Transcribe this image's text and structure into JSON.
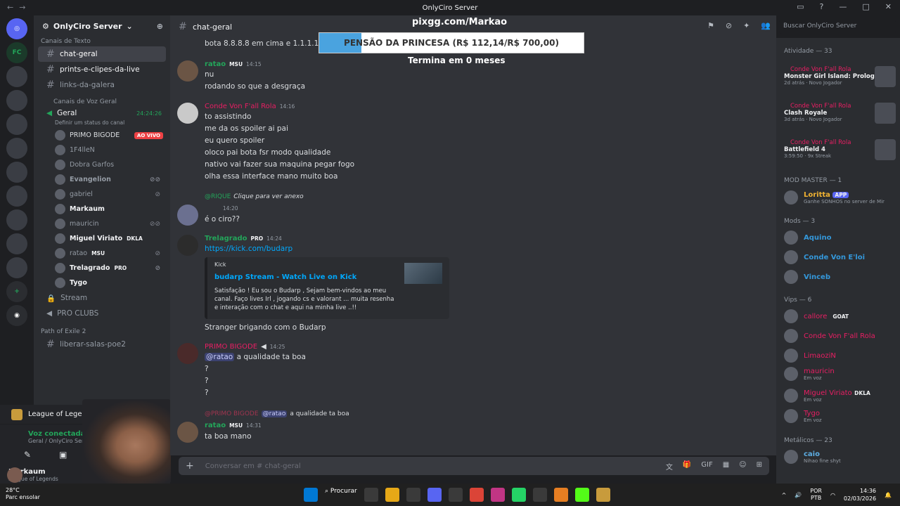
{
  "window": {
    "title": "OnlyCiro Server"
  },
  "server": {
    "name": "OnlyCiro Server",
    "search_placeholder": "Buscar OnlyCiro Server"
  },
  "overlay": {
    "url": "pixgg.com/Markao",
    "goal_label": "PENSÃO DA PRINCESA (R$ 112,14/R$ 700,00)",
    "goal_fraction": 0.16,
    "sub": "Termina em 0 meses"
  },
  "sidebar": {
    "cat_text": "Canais de Texto",
    "channels": [
      {
        "name": "chat-geral"
      },
      {
        "name": "prints-e-clipes-da-live"
      },
      {
        "name": "links-da-galera"
      }
    ],
    "cat_voice": "Canais de Voz Geral",
    "voice_channel": {
      "name": "Geral",
      "timer": "24:24:26",
      "status": "Definir um status do canal"
    },
    "voice_users": [
      {
        "name": "PRIMO BIGODE",
        "live": "AO VIVO"
      },
      {
        "name": "1F4lleN"
      },
      {
        "name": "Dobra Garfos"
      },
      {
        "name": "Evangelion"
      },
      {
        "name": "gabriel"
      },
      {
        "name": "Markaum"
      },
      {
        "name": "mauricin"
      },
      {
        "name": "Miguel Viriato",
        "tag": "DKLA"
      },
      {
        "name": "ratao",
        "tag": "MSU"
      },
      {
        "name": "Trelagrado",
        "tag": "PRO"
      },
      {
        "name": "Tygo"
      }
    ],
    "other": [
      {
        "name": "Stream"
      },
      {
        "name": "PRO CLUBS"
      }
    ],
    "cat_poe": "Path of Exile 2",
    "poe_channel": "liberar-salas-poe2"
  },
  "panel": {
    "game": "League of Legends",
    "voice": "Voz conectada",
    "voice_sub": "Geral / OnlyCiro Server",
    "user": "Markaum",
    "user_sub": "League of Legends"
  },
  "header": {
    "channel": "chat-geral"
  },
  "messages": [
    {
      "text": "bota 8.8.8.8 em cima e 1.1.1.1 em baix"
    },
    {
      "author": "ratao",
      "badge": "MSU",
      "time": "14:15",
      "lines": [
        "nu",
        "rodando so que a desgraça"
      ]
    },
    {
      "author": "Conde Von F'all  Rola",
      "time": "14:16",
      "lines": [
        "to assistindo",
        "me da os spoiler ai pai",
        "eu quero spoiler",
        "oloco pai bota fsr modo qualidade",
        "nativo vai fazer sua maquina pegar fogo",
        "olha essa interface mano muito boa"
      ]
    },
    {
      "reply": "@RIQUE",
      "reply_text": "Clique para ver anexo",
      "time": "14:20",
      "lines": [
        "é o ciro??"
      ]
    },
    {
      "author": "Trelagrado",
      "badge": "PRO",
      "time": "14:24",
      "link": "https://kick.com/budarp",
      "embed": {
        "provider": "Kick",
        "title": "budarp Stream - Watch Live on Kick",
        "desc": "Satisfação ! Eu sou o Budarp , Sejam bem-vindos ao meu canal. Faço lives Irl , jogando cs e valorant ... muita resenha e interação com o chat e aqui na minha live ..!!"
      },
      "after": "Stranger brigando com o Budarp"
    },
    {
      "author": "PRIMO BIGODE",
      "time": "14:25",
      "mention": "@ratao",
      "text": "a qualidade ta boa",
      "lines": [
        "?",
        "?",
        "?"
      ]
    },
    {
      "reply": "@PRIMO BIGODE",
      "reply_mention": "@ratao",
      "reply_text": "a qualidade ta boa",
      "author": "ratao",
      "badge": "MSU",
      "time": "14:31",
      "lines": [
        "ta boa mano"
      ]
    }
  ],
  "composer": {
    "placeholder": "Conversar em #  chat-geral"
  },
  "right": {
    "activity_label": "Atividade — 33",
    "activities": [
      {
        "name": "Conde Von F'all Rola",
        "game": "Monster Girl Island: Prolog...",
        "detail": "2d atrás",
        "note": "Novo Jogador"
      },
      {
        "name": "Conde Von F'all Rola",
        "game": "Clash Royale",
        "detail": "3d atrás",
        "note": "Novo Jogador"
      },
      {
        "name": "Conde Von F'all Rola",
        "game": "Battlefield 4",
        "detail": "3:59:50",
        "note": "9x Streak"
      }
    ],
    "mod_master": "MOD MASTER — 1",
    "loritta": {
      "name": "Loritta",
      "tag": "APP",
      "status": "Ganhe SONHOS no server de Mir"
    },
    "mods": "Mods — 3",
    "mod_list": [
      "Aquino",
      "Conde Von E'loi",
      "Vinceb"
    ],
    "vips": "Vips — 6",
    "vip_list": [
      {
        "name": "callore",
        "tag": "GOAT"
      },
      {
        "name": "Conde Von F'all Rola"
      },
      {
        "name": "LimaoziN"
      },
      {
        "name": "mauricin",
        "status": "Em voz"
      },
      {
        "name": "Miguel Viriato",
        "tag": "DKLA",
        "status": "Em voz"
      },
      {
        "name": "Tygo",
        "status": "Em voz"
      }
    ],
    "metal": "Metálicos — 23",
    "metal_list": [
      {
        "name": "caio",
        "status": "Nihao fine shyt"
      }
    ]
  },
  "taskbar": {
    "temp": "28°C",
    "weather": "Parc ensolar",
    "search": "Procurar",
    "lang": "POR",
    "layout": "PTB",
    "time": "14:36",
    "date": "02/03/2026"
  },
  "colors": {
    "accent": "#5865f2",
    "live": "#ed4245",
    "link": "#00a8fc"
  }
}
